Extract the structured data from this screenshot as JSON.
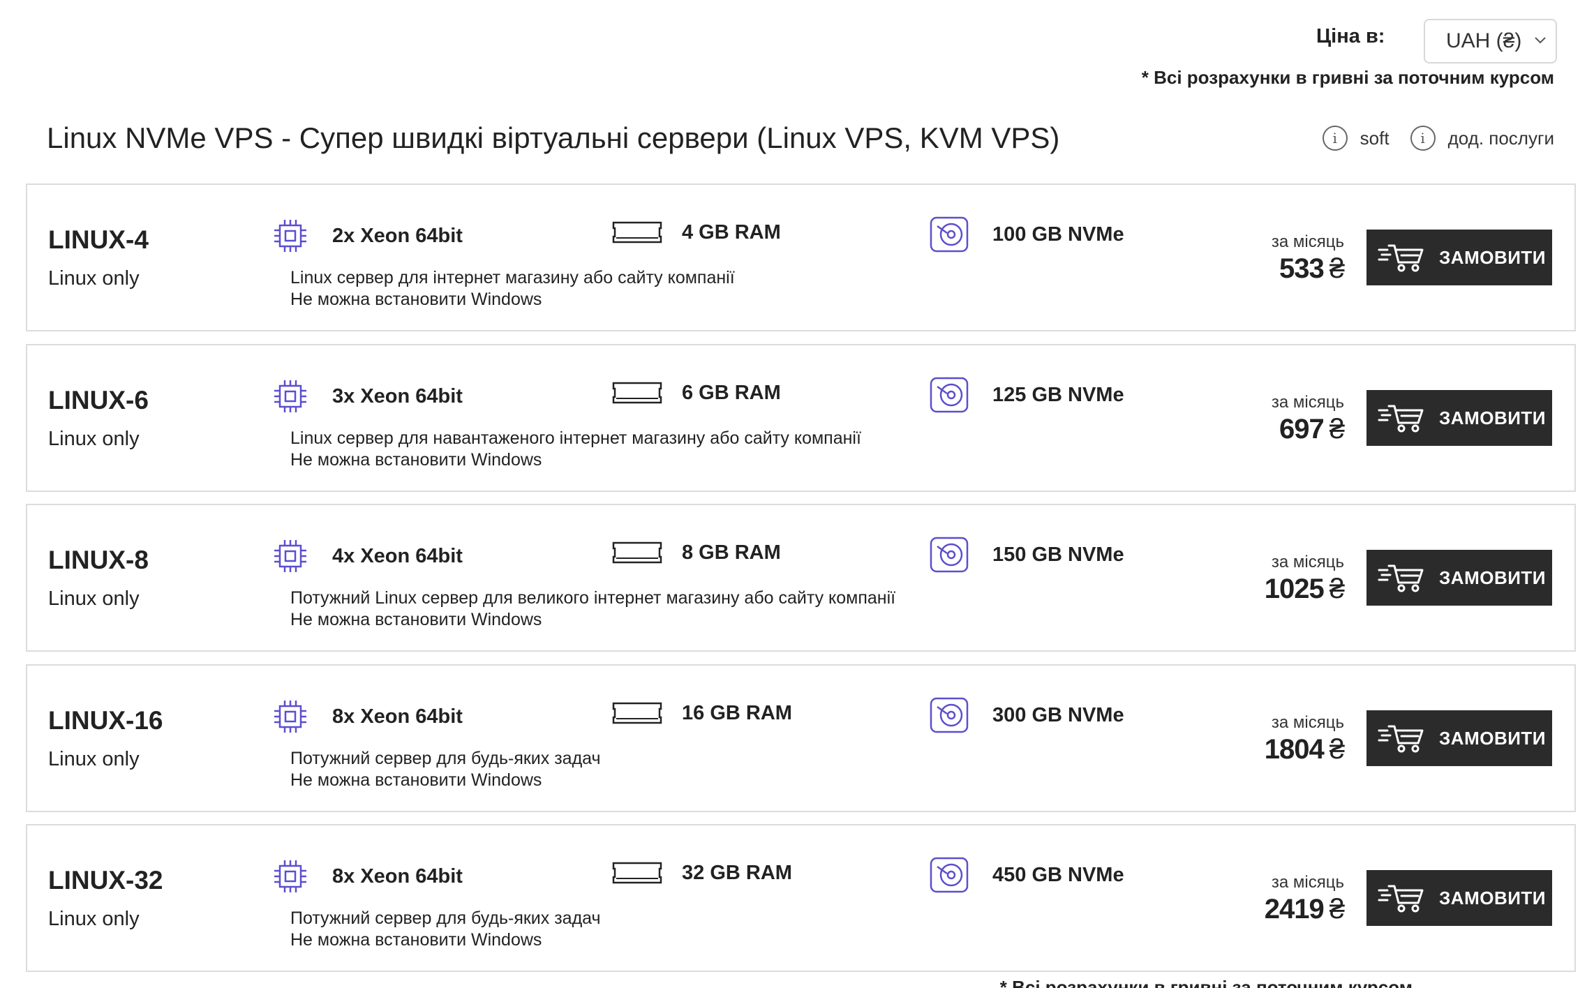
{
  "currency": {
    "label": "Ціна в:",
    "selected": "UAH (₴)",
    "note": "* Всі розрахунки в гривні за поточним курсом"
  },
  "title": "Linux NVMe VPS - Супер швидкі віртуальні сервери (Linux VPS, KVM VPS)",
  "info_links": [
    {
      "label": "soft",
      "icon": "info-icon"
    },
    {
      "label": "дод. послуги",
      "icon": "info-icon"
    }
  ],
  "accent_color": "#5b4fcf",
  "icons": {
    "cpu": "cpu-icon",
    "ram": "ram-icon",
    "disk": "disk-icon",
    "cart": "cart-icon"
  },
  "plans": [
    {
      "name": "LINUX-4",
      "sub": "Linux only",
      "cpu": "2x Xeon 64bit",
      "ram": "4 GB RAM",
      "disk": "100 GB NVMe",
      "desc1": "Linux сервер для інтернет магазину або сайту компанії",
      "desc2": "Не можна встановити Windows",
      "per_month": "за місяць",
      "price": "533",
      "currency_sign": "₴",
      "button": "ЗАМОВИТИ"
    },
    {
      "name": "LINUX-6",
      "sub": "Linux only",
      "cpu": "3x Xeon 64bit",
      "ram": "6 GB RAM",
      "disk": "125 GB NVMe",
      "desc1": "Linux сервер для навантаженого інтернет магазину або сайту компанії",
      "desc2": "Не можна встановити Windows",
      "per_month": "за місяць",
      "price": "697",
      "currency_sign": "₴",
      "button": "ЗАМОВИТИ"
    },
    {
      "name": "LINUX-8",
      "sub": "Linux only",
      "cpu": "4x Xeon 64bit",
      "ram": "8 GB RAM",
      "disk": "150 GB NVMe",
      "desc1": "Потужний Linux сервер для великого інтернет магазину або сайту компанії",
      "desc2": "Не можна встановити Windows",
      "per_month": "за місяць",
      "price": "1025",
      "currency_sign": "₴",
      "button": "ЗАМОВИТИ"
    },
    {
      "name": "LINUX-16",
      "sub": "Linux only",
      "cpu": "8x Xeon 64bit",
      "ram": "16 GB RAM",
      "disk": "300 GB NVMe",
      "desc1": "Потужний сервер для будь-яких задач",
      "desc2": "Не можна встановити Windows",
      "per_month": "за місяць",
      "price": "1804",
      "currency_sign": "₴",
      "button": "ЗАМОВИТИ"
    },
    {
      "name": "LINUX-32",
      "sub": "Linux only",
      "cpu": "8x Xeon 64bit",
      "ram": "32 GB RAM",
      "disk": "450 GB NVMe",
      "desc1": "Потужний сервер для будь-яких задач",
      "desc2": "Не можна встановити Windows",
      "per_month": "за місяць",
      "price": "2419",
      "currency_sign": "₴",
      "button": "ЗАМОВИТИ"
    }
  ],
  "bottom_note": "* Всі розрахунки в гривні за поточним курсом"
}
